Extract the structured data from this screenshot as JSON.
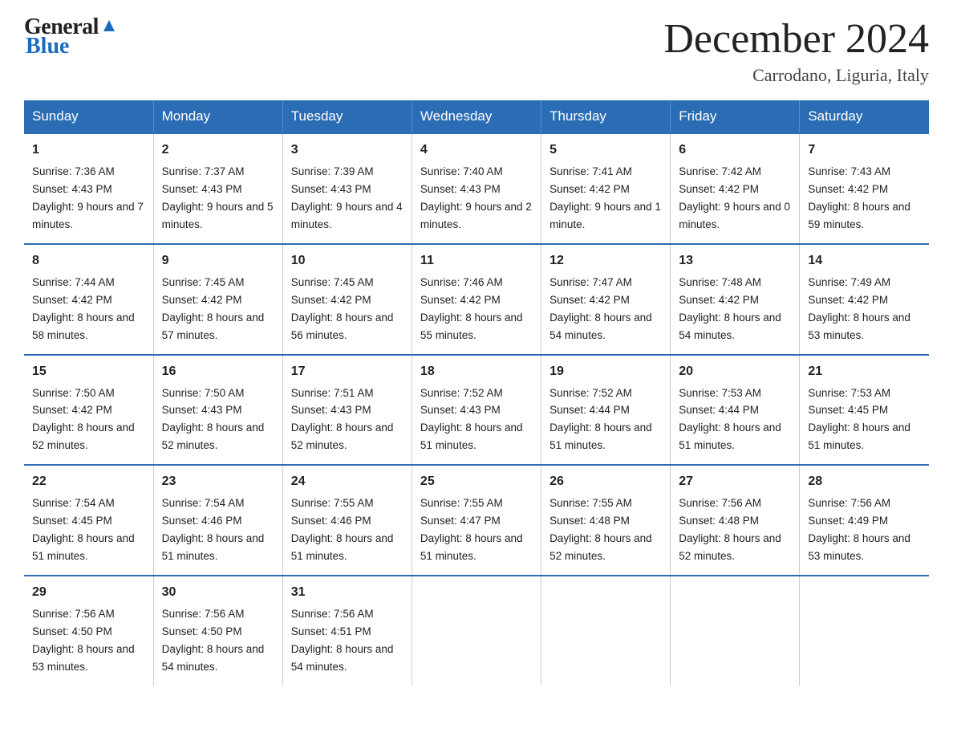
{
  "header": {
    "logo_general": "General",
    "logo_blue": "Blue",
    "month_title": "December 2024",
    "location": "Carrodano, Liguria, Italy"
  },
  "weekdays": [
    "Sunday",
    "Monday",
    "Tuesday",
    "Wednesday",
    "Thursday",
    "Friday",
    "Saturday"
  ],
  "weeks": [
    [
      {
        "day": "1",
        "sunrise": "7:36 AM",
        "sunset": "4:43 PM",
        "daylight": "9 hours and 7 minutes."
      },
      {
        "day": "2",
        "sunrise": "7:37 AM",
        "sunset": "4:43 PM",
        "daylight": "9 hours and 5 minutes."
      },
      {
        "day": "3",
        "sunrise": "7:39 AM",
        "sunset": "4:43 PM",
        "daylight": "9 hours and 4 minutes."
      },
      {
        "day": "4",
        "sunrise": "7:40 AM",
        "sunset": "4:43 PM",
        "daylight": "9 hours and 2 minutes."
      },
      {
        "day": "5",
        "sunrise": "7:41 AM",
        "sunset": "4:42 PM",
        "daylight": "9 hours and 1 minute."
      },
      {
        "day": "6",
        "sunrise": "7:42 AM",
        "sunset": "4:42 PM",
        "daylight": "9 hours and 0 minutes."
      },
      {
        "day": "7",
        "sunrise": "7:43 AM",
        "sunset": "4:42 PM",
        "daylight": "8 hours and 59 minutes."
      }
    ],
    [
      {
        "day": "8",
        "sunrise": "7:44 AM",
        "sunset": "4:42 PM",
        "daylight": "8 hours and 58 minutes."
      },
      {
        "day": "9",
        "sunrise": "7:45 AM",
        "sunset": "4:42 PM",
        "daylight": "8 hours and 57 minutes."
      },
      {
        "day": "10",
        "sunrise": "7:45 AM",
        "sunset": "4:42 PM",
        "daylight": "8 hours and 56 minutes."
      },
      {
        "day": "11",
        "sunrise": "7:46 AM",
        "sunset": "4:42 PM",
        "daylight": "8 hours and 55 minutes."
      },
      {
        "day": "12",
        "sunrise": "7:47 AM",
        "sunset": "4:42 PM",
        "daylight": "8 hours and 54 minutes."
      },
      {
        "day": "13",
        "sunrise": "7:48 AM",
        "sunset": "4:42 PM",
        "daylight": "8 hours and 54 minutes."
      },
      {
        "day": "14",
        "sunrise": "7:49 AM",
        "sunset": "4:42 PM",
        "daylight": "8 hours and 53 minutes."
      }
    ],
    [
      {
        "day": "15",
        "sunrise": "7:50 AM",
        "sunset": "4:42 PM",
        "daylight": "8 hours and 52 minutes."
      },
      {
        "day": "16",
        "sunrise": "7:50 AM",
        "sunset": "4:43 PM",
        "daylight": "8 hours and 52 minutes."
      },
      {
        "day": "17",
        "sunrise": "7:51 AM",
        "sunset": "4:43 PM",
        "daylight": "8 hours and 52 minutes."
      },
      {
        "day": "18",
        "sunrise": "7:52 AM",
        "sunset": "4:43 PM",
        "daylight": "8 hours and 51 minutes."
      },
      {
        "day": "19",
        "sunrise": "7:52 AM",
        "sunset": "4:44 PM",
        "daylight": "8 hours and 51 minutes."
      },
      {
        "day": "20",
        "sunrise": "7:53 AM",
        "sunset": "4:44 PM",
        "daylight": "8 hours and 51 minutes."
      },
      {
        "day": "21",
        "sunrise": "7:53 AM",
        "sunset": "4:45 PM",
        "daylight": "8 hours and 51 minutes."
      }
    ],
    [
      {
        "day": "22",
        "sunrise": "7:54 AM",
        "sunset": "4:45 PM",
        "daylight": "8 hours and 51 minutes."
      },
      {
        "day": "23",
        "sunrise": "7:54 AM",
        "sunset": "4:46 PM",
        "daylight": "8 hours and 51 minutes."
      },
      {
        "day": "24",
        "sunrise": "7:55 AM",
        "sunset": "4:46 PM",
        "daylight": "8 hours and 51 minutes."
      },
      {
        "day": "25",
        "sunrise": "7:55 AM",
        "sunset": "4:47 PM",
        "daylight": "8 hours and 51 minutes."
      },
      {
        "day": "26",
        "sunrise": "7:55 AM",
        "sunset": "4:48 PM",
        "daylight": "8 hours and 52 minutes."
      },
      {
        "day": "27",
        "sunrise": "7:56 AM",
        "sunset": "4:48 PM",
        "daylight": "8 hours and 52 minutes."
      },
      {
        "day": "28",
        "sunrise": "7:56 AM",
        "sunset": "4:49 PM",
        "daylight": "8 hours and 53 minutes."
      }
    ],
    [
      {
        "day": "29",
        "sunrise": "7:56 AM",
        "sunset": "4:50 PM",
        "daylight": "8 hours and 53 minutes."
      },
      {
        "day": "30",
        "sunrise": "7:56 AM",
        "sunset": "4:50 PM",
        "daylight": "8 hours and 54 minutes."
      },
      {
        "day": "31",
        "sunrise": "7:56 AM",
        "sunset": "4:51 PM",
        "daylight": "8 hours and 54 minutes."
      },
      null,
      null,
      null,
      null
    ]
  ],
  "labels": {
    "sunrise": "Sunrise:",
    "sunset": "Sunset:",
    "daylight": "Daylight:"
  }
}
